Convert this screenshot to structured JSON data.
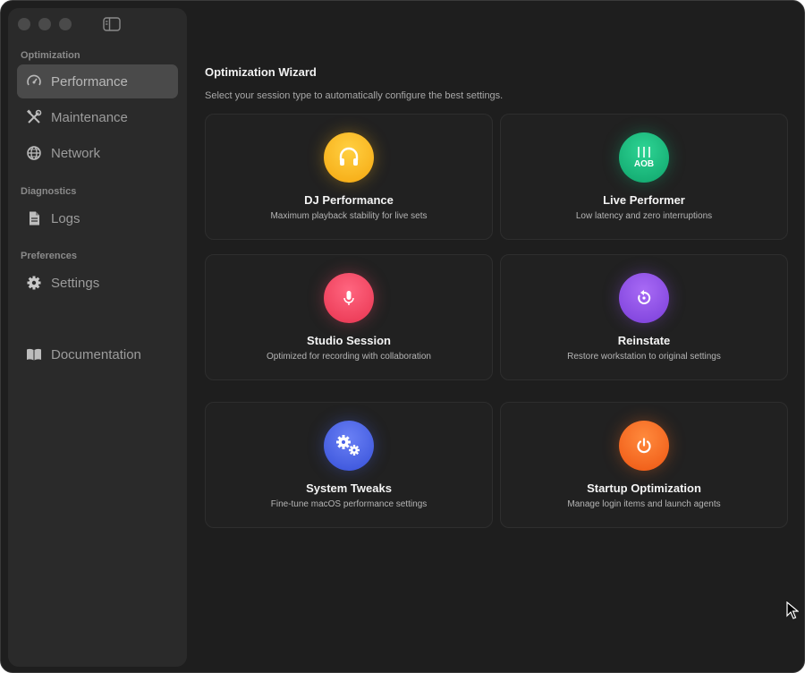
{
  "sidebar": {
    "sections": {
      "optimization": "Optimization",
      "diagnostics": "Diagnostics",
      "preferences": "Preferences"
    },
    "items": [
      {
        "label": "Performance",
        "icon": "performance-gauge-icon",
        "active": true
      },
      {
        "label": "Maintenance",
        "icon": "tools-icon"
      },
      {
        "label": "Network",
        "icon": "globe-icon"
      },
      {
        "label": "Logs",
        "icon": "document-icon"
      },
      {
        "label": "Settings",
        "icon": "gear-icon"
      },
      {
        "label": "Documentation",
        "icon": "book-icon"
      }
    ]
  },
  "main": {
    "title": "Optimization Wizard",
    "subtitle": "Select your session type to automatically configure the best settings.",
    "cards": [
      {
        "title": "DJ Performance",
        "desc": "Maximum playback stability for live sets",
        "icon": "headphones-icon",
        "color": "#f5b219"
      },
      {
        "title": "Live Performer",
        "desc": "Low latency and zero interruptions",
        "icon": "guitars-icon",
        "color": "#15b97c"
      },
      {
        "title": "Studio Session",
        "desc": "Optimized for recording with collaboration",
        "icon": "microphone-icon",
        "color": "#ef4b68"
      },
      {
        "title": "Reinstate",
        "desc": "Restore workstation to original settings",
        "icon": "restore-icon",
        "color": "#8f4fe6"
      },
      {
        "title": "System Tweaks",
        "desc": "Fine-tune macOS performance settings",
        "icon": "gears-icon",
        "color": "#4961e6"
      },
      {
        "title": "Startup Optimization",
        "desc": "Manage login items and launch agents",
        "icon": "power-icon",
        "color": "#f56a23"
      }
    ]
  }
}
